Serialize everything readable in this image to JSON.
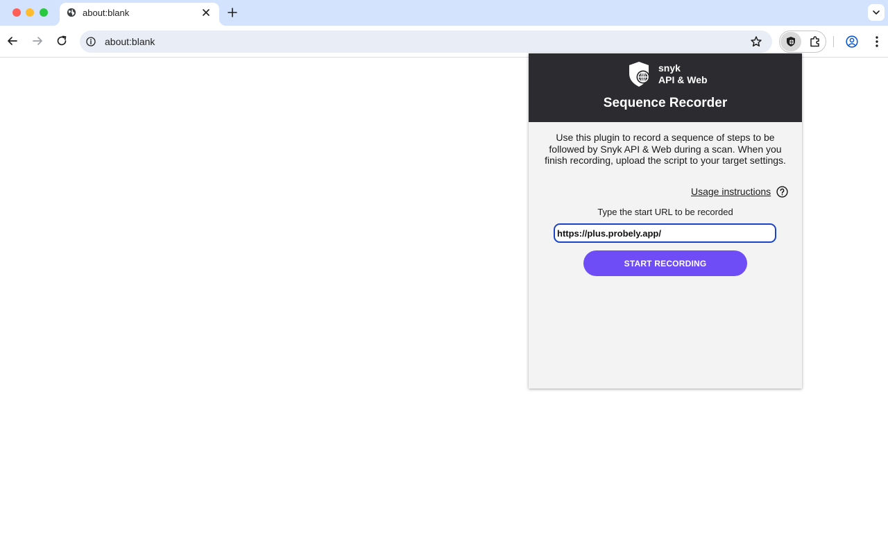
{
  "browser": {
    "tab": {
      "title": "about:blank"
    },
    "address_bar": {
      "url": "about:blank"
    }
  },
  "popup": {
    "brand": {
      "name": "snyk",
      "product": "API & Web"
    },
    "title": "Sequence Recorder",
    "description": "Use this plugin to record a sequence of steps to be followed by Snyk API & Web during a scan. When you finish recording, upload the script to your target settings.",
    "usage_link": "Usage instructions",
    "url_label": "Type the start URL to be recorded",
    "url_value": "https://plus.probely.app/",
    "start_button": "START RECORDING"
  },
  "colors": {
    "tabstrip": "#d3e3fd",
    "header_bg": "#2c2c30",
    "accent_button": "#6f4df6",
    "input_border": "#1a43c9"
  }
}
